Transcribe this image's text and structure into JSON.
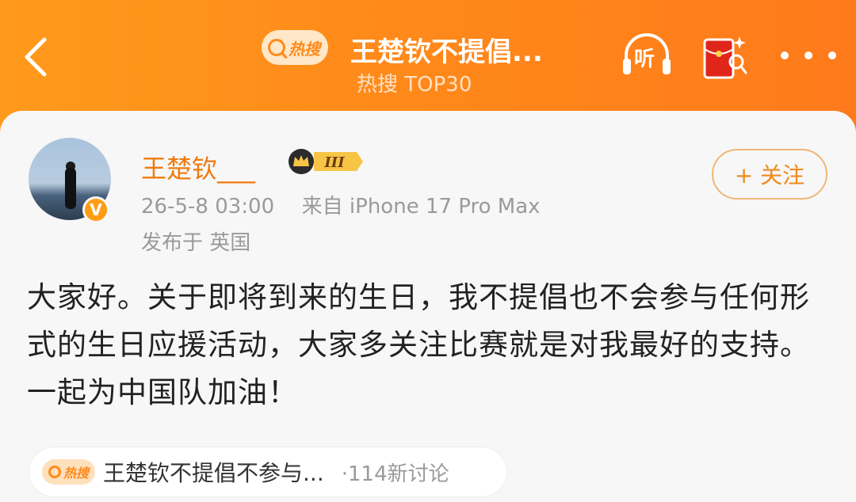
{
  "header": {
    "hot_label": "热搜",
    "title": "王楚钦不提倡...",
    "subtitle": "热搜 TOP30",
    "listen_label": "听"
  },
  "post": {
    "username": "王楚钦___",
    "level": "III",
    "timestamp": "26-5-8 03:00",
    "source": "来自 iPhone 17 Pro Max",
    "location": "发布于 英国",
    "follow_label": "+ 关注",
    "verified_badge": "V",
    "body": "大家好。关于即将到来的生日，我不提倡也不会参与任何形式的生日应援活动，大家多关注比赛就是对我最好的支持。一起为中国队加油！"
  },
  "topic": {
    "hot_label": "热搜",
    "title": "王楚钦不提倡不参与...",
    "discussion": "·114新讨论"
  },
  "colors": {
    "header_orange": "#ff8a1a",
    "username_orange": "#f07a10",
    "follow_border": "#f0b676"
  }
}
